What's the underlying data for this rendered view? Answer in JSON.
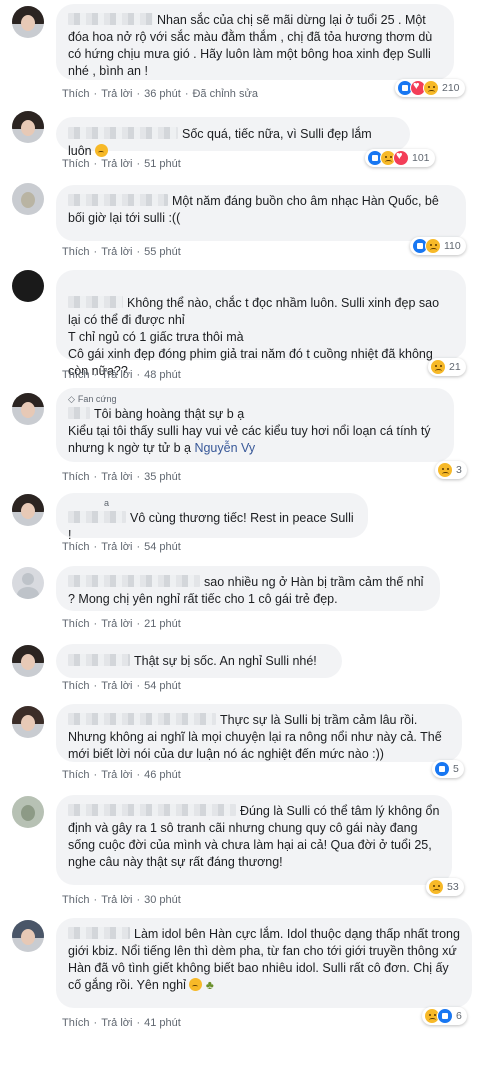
{
  "comments": [
    {
      "badge": "",
      "text": "Nhan sắc của chị sẽ mãi dừng lại ở tuổi 25 . Một đóa hoa nở rộ với sắc màu đằm thắm , chị đã tỏa hương thơm dù có hứng chịu mưa gió . Hãy luôn làm một bông hoa xinh đẹp Sulli nhé , bình an !",
      "like": "Thích",
      "reply": "Trả lời",
      "time": "36 phút",
      "extra": "Đã chỉnh sửa",
      "reactions": [
        "like",
        "love",
        "sad"
      ],
      "count": "210"
    },
    {
      "badge": "",
      "text": "Sốc quá, tiếc nữa, vì Sulli đẹp lắm luôn",
      "like": "Thích",
      "reply": "Trả lời",
      "time": "51 phút",
      "extra": "",
      "reactions": [
        "like",
        "sad",
        "love"
      ],
      "count": "101"
    },
    {
      "badge": "",
      "text": "Một năm đáng buồn cho âm nhạc Hàn Quốc, bê bối giờ lại tới sulli :((",
      "like": "Thích",
      "reply": "Trả lời",
      "time": "55 phút",
      "extra": "",
      "reactions": [
        "like",
        "sad"
      ],
      "count": "110"
    },
    {
      "badge": "",
      "text": "Không thể nào, chắc t đọc nhầm luôn. Sulli xinh đẹp sao lại có thể đi được nhỉ\nT chỉ ngủ có 1 giấc trưa thôi mà\nCô gái xinh đẹp đóng phim giả trai năm đó t cuồng nhiệt đã không còn nữa??",
      "like": "Thích",
      "reply": "Trả lời",
      "time": "48 phút",
      "extra": "",
      "reactions": [
        "sad"
      ],
      "count": "21"
    },
    {
      "badge": "Fan cứng",
      "text": "Tôi bàng hoàng thật sự b ạ\nKiểu tại tôi thấy sulli hay vui vẻ các kiểu tuy hơi nổi loạn cá tính tý nhưng k ngờ tự tử b ạ",
      "mention": "Nguyễn Vy",
      "like": "Thích",
      "reply": "Trả lời",
      "time": "35 phút",
      "extra": "",
      "reactions": [
        "sad"
      ],
      "count": "3"
    },
    {
      "badge": "a",
      "text": "Vô cùng thương tiếc! Rest in peace Sulli !",
      "like": "Thích",
      "reply": "Trả lời",
      "time": "54 phút",
      "extra": "",
      "reactions": [],
      "count": ""
    },
    {
      "badge": "",
      "text": "sao nhiều ng ở Hàn bị trầm cảm thế nhỉ ? Mong chị yên nghỉ rất tiếc cho 1 cô gái trẻ đẹp.",
      "like": "Thích",
      "reply": "Trả lời",
      "time": "21 phút",
      "extra": "",
      "reactions": [],
      "count": ""
    },
    {
      "badge": "",
      "text": "Thật sự bị sốc. An nghỉ Sulli nhé!",
      "like": "Thích",
      "reply": "Trả lời",
      "time": "54 phút",
      "extra": "",
      "reactions": [],
      "count": ""
    },
    {
      "badge": "",
      "text": "Thực sự là Sulli bị trầm cảm lâu rồi. Nhưng không ai nghĩ là mọi chuyện lại ra nông nổi như này cả. Thế mới biết lời nói của dư luận nó ác nghiệt đến mức nào :))",
      "like": "Thích",
      "reply": "Trả lời",
      "time": "46 phút",
      "extra": "",
      "reactions": [
        "like"
      ],
      "count": "5"
    },
    {
      "badge": "",
      "text": "Đúng là Sulli có thể tâm lý không ổn định và gây ra 1 sô tranh cãi nhưng chung quy cô gái này đang sống cuộc đời của mình và chưa làm hại ai cả! Qua đời ở tuổi 25, nghe câu này thật sự rất đáng thương!",
      "like": "Thích",
      "reply": "Trả lời",
      "time": "30 phút",
      "extra": "",
      "reactions": [
        "sad"
      ],
      "count": "53"
    },
    {
      "badge": "",
      "text": "Làm idol bên Hàn cực lắm. Idol thuộc dạng thấp nhất trong giới kbiz. Nổi tiếng lên thì dèm pha, từ fan cho tới giới truyền thông xứ Hàn đã vô tình giết không biết bao nhiêu idol. Sulli rất cô đơn. Chị ấy cố gắng rồi. Yên nghỉ",
      "like": "Thích",
      "reply": "Trả lời",
      "time": "41 phút",
      "extra": "",
      "reactions": [
        "sad",
        "like"
      ],
      "count": "6"
    }
  ]
}
